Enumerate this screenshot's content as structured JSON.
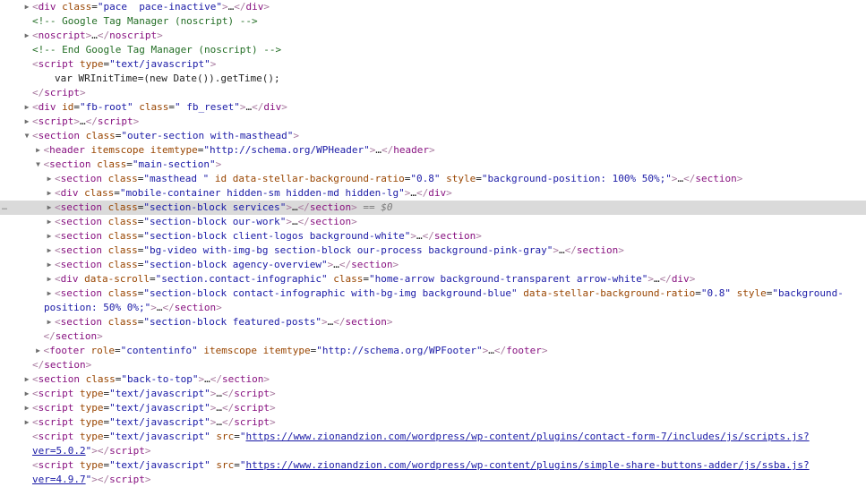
{
  "panel": "Elements",
  "selected_marker": "== $0",
  "colors": {
    "tag": "#881280",
    "attr_name": "#994500",
    "attr_value": "#1a1aa6",
    "comment": "#236e25",
    "selected_bg": "#dadada",
    "link": "#1a1aa6"
  },
  "nodes": [
    {
      "depth": 0,
      "toggle": "collapsed",
      "kind": "element",
      "tag": "div",
      "attrs": [
        {
          "name": "class",
          "value": "pace  pace-inactive"
        }
      ],
      "collapsed": true
    },
    {
      "depth": 0,
      "toggle": "none",
      "kind": "comment",
      "text": "<!-- Google Tag Manager (noscript) -->"
    },
    {
      "depth": 0,
      "toggle": "collapsed",
      "kind": "element",
      "tag": "noscript",
      "attrs": [],
      "collapsed": true
    },
    {
      "depth": 0,
      "toggle": "none",
      "kind": "comment",
      "text": "<!-- End Google Tag Manager (noscript) -->"
    },
    {
      "depth": 0,
      "toggle": "none",
      "kind": "open",
      "tag": "script",
      "attrs": [
        {
          "name": "type",
          "value": "text/javascript"
        }
      ]
    },
    {
      "depth": 2,
      "toggle": "none",
      "kind": "text",
      "text": "var WRInitTime=(new Date()).getTime();"
    },
    {
      "depth": 0,
      "toggle": "none",
      "kind": "close",
      "tag": "script"
    },
    {
      "depth": 0,
      "toggle": "collapsed",
      "kind": "element",
      "tag": "div",
      "attrs": [
        {
          "name": "id",
          "value": "fb-root"
        },
        {
          "name": "class",
          "value": " fb_reset"
        }
      ],
      "collapsed": true
    },
    {
      "depth": 0,
      "toggle": "collapsed",
      "kind": "element",
      "tag": "script",
      "attrs": [],
      "collapsed": true
    },
    {
      "depth": 0,
      "toggle": "expanded",
      "kind": "open",
      "tag": "section",
      "attrs": [
        {
          "name": "class",
          "value": "outer-section with-masthead"
        }
      ]
    },
    {
      "depth": 1,
      "toggle": "collapsed",
      "kind": "element",
      "tag": "header",
      "attrs": [
        {
          "name": "itemscope",
          "value": null
        },
        {
          "name": "itemtype",
          "value": "http://schema.org/WPHeader"
        }
      ],
      "collapsed": true
    },
    {
      "depth": 1,
      "toggle": "expanded",
      "kind": "open",
      "tag": "section",
      "attrs": [
        {
          "name": "class",
          "value": "main-section"
        }
      ]
    },
    {
      "depth": 2,
      "toggle": "collapsed",
      "kind": "element",
      "tag": "section",
      "attrs": [
        {
          "name": "class",
          "value": "masthead "
        },
        {
          "name": "id",
          "value": null
        },
        {
          "name": "data-stellar-background-ratio",
          "value": "0.8"
        },
        {
          "name": "style",
          "value": "background-position: 100% 50%;"
        }
      ],
      "collapsed": true
    },
    {
      "depth": 2,
      "toggle": "collapsed",
      "kind": "element",
      "tag": "div",
      "attrs": [
        {
          "name": "class",
          "value": "mobile-container hidden-sm hidden-md hidden-lg"
        }
      ],
      "collapsed": true
    },
    {
      "depth": 2,
      "toggle": "collapsed",
      "kind": "element",
      "tag": "section",
      "attrs": [
        {
          "name": "class",
          "value": "section-block services"
        }
      ],
      "collapsed": true,
      "selected": true
    },
    {
      "depth": 2,
      "toggle": "collapsed",
      "kind": "element",
      "tag": "section",
      "attrs": [
        {
          "name": "class",
          "value": "section-block our-work"
        }
      ],
      "collapsed": true
    },
    {
      "depth": 2,
      "toggle": "collapsed",
      "kind": "element",
      "tag": "section",
      "attrs": [
        {
          "name": "class",
          "value": "section-block client-logos background-white"
        }
      ],
      "collapsed": true
    },
    {
      "depth": 2,
      "toggle": "collapsed",
      "kind": "element",
      "tag": "section",
      "attrs": [
        {
          "name": "class",
          "value": "bg-video with-img-bg section-block our-process background-pink-gray"
        }
      ],
      "collapsed": true
    },
    {
      "depth": 2,
      "toggle": "collapsed",
      "kind": "element",
      "tag": "section",
      "attrs": [
        {
          "name": "class",
          "value": "section-block agency-overview"
        }
      ],
      "collapsed": true
    },
    {
      "depth": 2,
      "toggle": "collapsed",
      "kind": "element",
      "tag": "div",
      "attrs": [
        {
          "name": "data-scroll",
          "value": "section.contact-infographic"
        },
        {
          "name": "class",
          "value": "home-arrow background-transparent arrow-white"
        }
      ],
      "collapsed": true
    },
    {
      "depth": 2,
      "toggle": "collapsed",
      "kind": "element",
      "tag": "section",
      "attrs": [
        {
          "name": "class",
          "value": "section-block contact-infographic with-bg-img background-blue"
        },
        {
          "name": "data-stellar-background-ratio",
          "value": "0.8"
        },
        {
          "name": "style",
          "value": "background-position: 50% 0%;"
        }
      ],
      "collapsed": true,
      "wrap_at": "background-",
      "wrap_rest": "position: 50% 0%;"
    },
    {
      "depth": 2,
      "toggle": "collapsed",
      "kind": "element",
      "tag": "section",
      "attrs": [
        {
          "name": "class",
          "value": "section-block featured-posts"
        }
      ],
      "collapsed": true
    },
    {
      "depth": 1,
      "toggle": "none",
      "kind": "close",
      "tag": "section"
    },
    {
      "depth": 1,
      "toggle": "collapsed",
      "kind": "element",
      "tag": "footer",
      "attrs": [
        {
          "name": "role",
          "value": "contentinfo"
        },
        {
          "name": "itemscope",
          "value": null
        },
        {
          "name": "itemtype",
          "value": "http://schema.org/WPFooter"
        }
      ],
      "collapsed": true
    },
    {
      "depth": 0,
      "toggle": "none",
      "kind": "close",
      "tag": "section"
    },
    {
      "depth": 0,
      "toggle": "collapsed",
      "kind": "element",
      "tag": "section",
      "attrs": [
        {
          "name": "class",
          "value": "back-to-top"
        }
      ],
      "collapsed": true
    },
    {
      "depth": 0,
      "toggle": "collapsed",
      "kind": "element",
      "tag": "script",
      "attrs": [
        {
          "name": "type",
          "value": "text/javascript"
        }
      ],
      "collapsed": true
    },
    {
      "depth": 0,
      "toggle": "collapsed",
      "kind": "element",
      "tag": "script",
      "attrs": [
        {
          "name": "type",
          "value": "text/javascript"
        }
      ],
      "collapsed": true
    },
    {
      "depth": 0,
      "toggle": "collapsed",
      "kind": "element",
      "tag": "script",
      "attrs": [
        {
          "name": "type",
          "value": "text/javascript"
        }
      ],
      "collapsed": true
    },
    {
      "depth": 0,
      "toggle": "none",
      "kind": "script-src",
      "tag": "script",
      "type": "text/javascript",
      "src_line1": "https://www.zionandzion.com/wordpress/wp-content/plugins/contact-form-7/includes/js/scripts.js?",
      "src_line2": "ver=5.0.2"
    },
    {
      "depth": 0,
      "toggle": "none",
      "kind": "script-src",
      "tag": "script",
      "type": "text/javascript",
      "src_line1": "https://www.zionandzion.com/wordpress/wp-content/plugins/simple-share-buttons-adder/js/ssba.js?",
      "src_line2": "ver=4.9.7"
    }
  ]
}
